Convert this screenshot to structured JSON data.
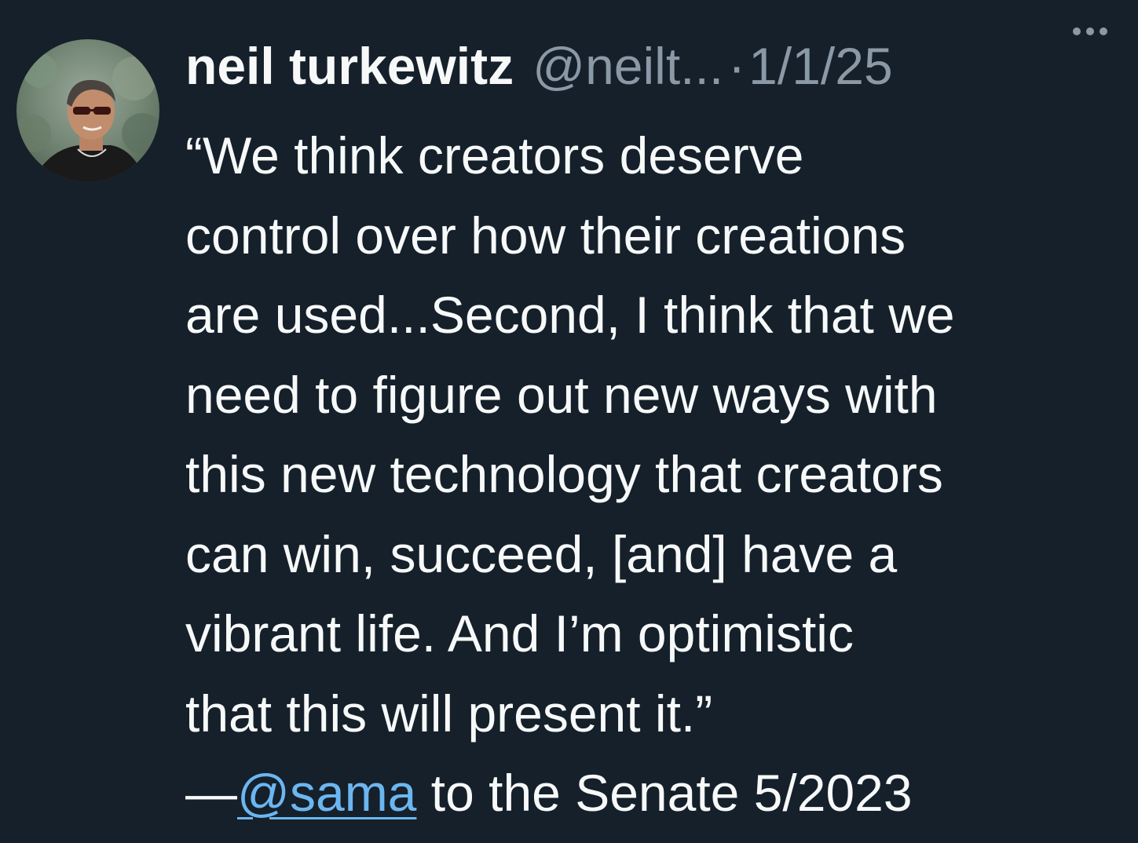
{
  "tweet": {
    "author": {
      "display_name": "neil turkewitz",
      "handle": "@neilt...",
      "avatar_icon": "profile-photo"
    },
    "separator": "·",
    "timestamp": "1/1/25",
    "more_icon": "more-horizontal-icon",
    "body": {
      "lines": [
        "“We think creators deserve",
        "control over how their creations",
        "are used...Second, I think that we",
        "need to figure out new ways with",
        "this new technology that creators",
        "can win, succeed, [and] have a",
        "vibrant life. And I’m optimistic",
        "that this will present it.”"
      ],
      "attribution_prefix": "—",
      "mention": "@sama",
      "attribution_suffix": " to the Senate 5/2023"
    }
  },
  "colors": {
    "background": "#15202b",
    "text": "#f7f9f9",
    "secondary_text": "#8b98a5",
    "link": "#6cb6f0"
  }
}
